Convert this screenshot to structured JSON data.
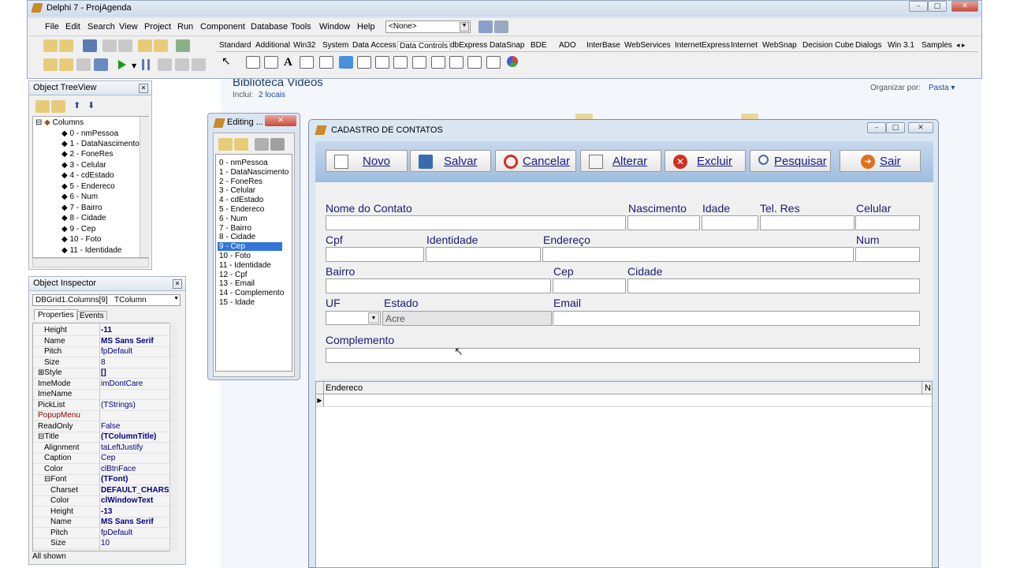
{
  "ide": {
    "title": "Delphi 7 - ProjAgenda",
    "menu": [
      "File",
      "Edit",
      "Search",
      "View",
      "Project",
      "Run",
      "Component",
      "Database",
      "Tools",
      "Window",
      "Help"
    ],
    "combo_value": "<None>",
    "palette_tabs": [
      "Standard",
      "Additional",
      "Win32",
      "System",
      "Data Access",
      "Data Controls",
      "dbExpress",
      "DataSnap",
      "BDE",
      "ADO",
      "InterBase",
      "WebServices",
      "InternetExpress",
      "Internet",
      "WebSnap",
      "Decision Cube",
      "Dialogs",
      "Win 3.1",
      "Samples"
    ]
  },
  "explorer": {
    "title": "Biblioteca Videos",
    "includes_label": "Inclui:",
    "includes_value": "2 locais",
    "organize_label": "Organizar por:",
    "organize_value": "Pasta"
  },
  "tree_view": {
    "title": "Object TreeView",
    "root": "Columns",
    "items": [
      "0 - nmPessoa",
      "1 - DataNascimento",
      "2 - FoneRes",
      "3 - Celular",
      "4 - cdEstado",
      "5 - Endereco",
      "6 - Num",
      "7 - Bairro",
      "8 - Cidade",
      "9 - Cep",
      "10 - Foto",
      "11 - Identidade"
    ]
  },
  "inspector": {
    "title": "Object Inspector",
    "object_name": "DBGrid1.Columns[9]",
    "object_type": "TColumn",
    "tabs": [
      "Properties",
      "Events"
    ],
    "rows": [
      {
        "prop": "Height",
        "val": "-11",
        "indent": 1,
        "bold": true
      },
      {
        "prop": "Name",
        "val": "MS Sans Serif",
        "indent": 1,
        "bold": true
      },
      {
        "prop": "Pitch",
        "val": "fpDefault",
        "indent": 1,
        "bold": false
      },
      {
        "prop": "Size",
        "val": "8",
        "indent": 1,
        "bold": false
      },
      {
        "prop": "⊞Style",
        "val": "[]",
        "indent": 0,
        "bold": true
      },
      {
        "prop": "ImeMode",
        "val": "imDontCare",
        "indent": 0,
        "bold": false
      },
      {
        "prop": "ImeName",
        "val": "",
        "indent": 0,
        "bold": false
      },
      {
        "prop": "PickList",
        "val": "(TStrings)",
        "indent": 0,
        "bold": false
      },
      {
        "prop": "PopupMenu",
        "val": "",
        "indent": 0,
        "bold": false
      },
      {
        "prop": "ReadOnly",
        "val": "False",
        "indent": 0,
        "bold": false
      },
      {
        "prop": "⊟Title",
        "val": "(TColumnTitle)",
        "indent": 0,
        "bold": true
      },
      {
        "prop": "Alignment",
        "val": "taLeftJustify",
        "indent": 1,
        "bold": false
      },
      {
        "prop": "Caption",
        "val": "Cep",
        "indent": 1,
        "bold": false
      },
      {
        "prop": "Color",
        "val": "clBtnFace",
        "indent": 1,
        "bold": false
      },
      {
        "prop": "⊟Font",
        "val": "(TFont)",
        "indent": 1,
        "bold": true
      },
      {
        "prop": "Charset",
        "val": "DEFAULT_CHARS",
        "indent": 2,
        "bold": true
      },
      {
        "prop": "Color",
        "val": "clWindowText",
        "indent": 2,
        "bold": true
      },
      {
        "prop": "Height",
        "val": "-13",
        "indent": 2,
        "bold": true
      },
      {
        "prop": "Name",
        "val": "MS Sans Serif",
        "indent": 2,
        "bold": true
      },
      {
        "prop": "Pitch",
        "val": "fpDefault",
        "indent": 2,
        "bold": false
      },
      {
        "prop": "Size",
        "val": "10",
        "indent": 2,
        "bold": false
      }
    ],
    "status": "All shown"
  },
  "editing": {
    "title": "Editing ...",
    "items": [
      "0 - nmPessoa",
      "1 - DataNascimento",
      "2 - FoneRes",
      "3 - Celular",
      "4 - cdEstado",
      "5 - Endereco",
      "6 - Num",
      "7 - Bairro",
      "8 - Cidade",
      "9 - Cep",
      "10 - Foto",
      "11 - Identidade",
      "12 - Cpf",
      "13 - Email",
      "14 - Complemento",
      "15 - Idade"
    ],
    "selected_index": 9
  },
  "form": {
    "title": "CADASTRO DE CONTATOS",
    "buttons": {
      "novo": "Novo",
      "salvar": "Salvar",
      "cancelar": "Cancelar",
      "alterar": "Alterar",
      "excluir": "Excluir",
      "pesquisar": "Pesquisar",
      "sair": "Sair"
    },
    "labels": {
      "nome": "Nome do Contato",
      "nascimento": "Nascimento",
      "idade": "Idade",
      "telres": "Tel. Res",
      "celular": "Celular",
      "cpf": "Cpf",
      "identidade": "Identidade",
      "endereco": "Endereço",
      "num": "Num",
      "bairro": "Bairro",
      "cep": "Cep",
      "cidade": "Cidade",
      "uf": "UF",
      "estado": "Estado",
      "email": "Email",
      "complemento": "Complemento"
    },
    "estado_value": "Acre",
    "grid_headers": [
      "Endereco",
      "N"
    ]
  }
}
